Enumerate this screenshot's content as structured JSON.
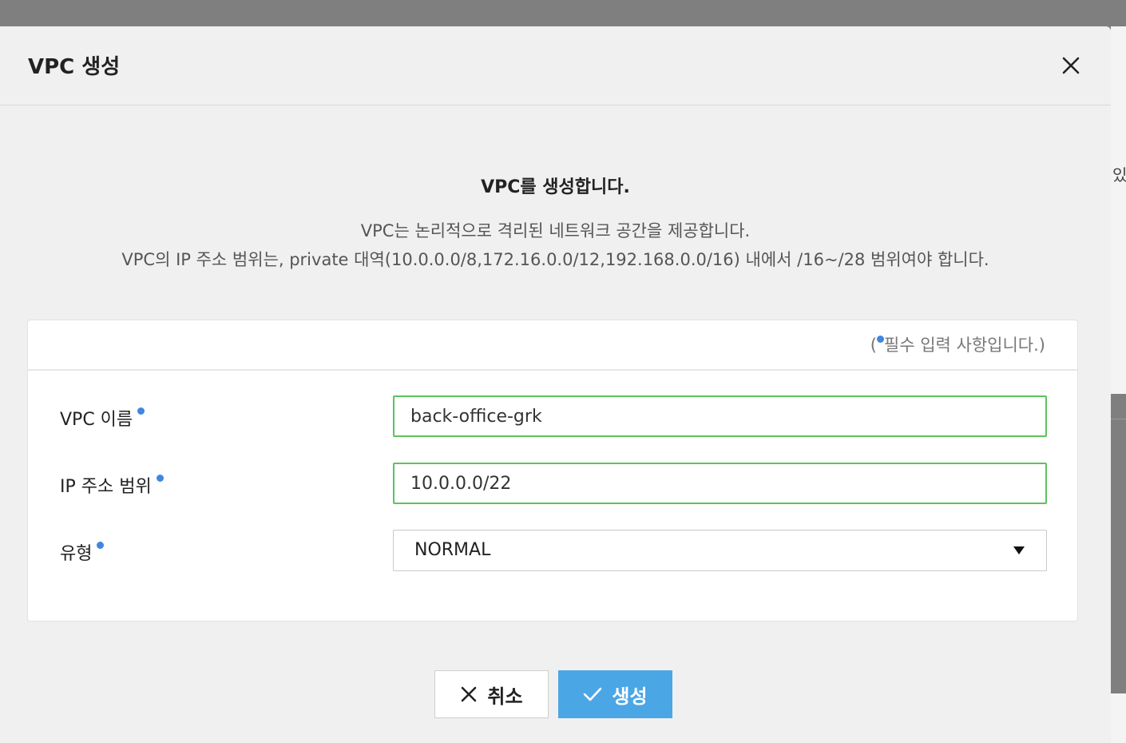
{
  "background": {
    "partial_text": "있"
  },
  "dialog": {
    "title": "VPC 생성",
    "close_icon": "close-icon"
  },
  "intro": {
    "heading": "VPC를 생성합니다.",
    "description_line1": "VPC는 논리적으로 격리된 네트워크 공간을 제공합니다.",
    "description_line2": "VPC의 IP 주소 범위는, private 대역(10.0.0.0/8,172.16.0.0/12,192.168.0.0/16) 내에서 /16~/28 범위여야 합니다."
  },
  "form": {
    "required_note_open": "(",
    "required_note_text": "필수 입력 사항입니다.)",
    "fields": {
      "vpc_name": {
        "label": "VPC 이름",
        "value": "back-office-grk"
      },
      "ip_range": {
        "label": "IP 주소 범위",
        "value": "10.0.0.0/22"
      },
      "type": {
        "label": "유형",
        "value": "NORMAL"
      }
    }
  },
  "buttons": {
    "cancel": "취소",
    "create": "생성"
  },
  "colors": {
    "accent": "#4ba6e6",
    "required_dot": "#3f87e0",
    "valid_border": "#5cc35c"
  }
}
